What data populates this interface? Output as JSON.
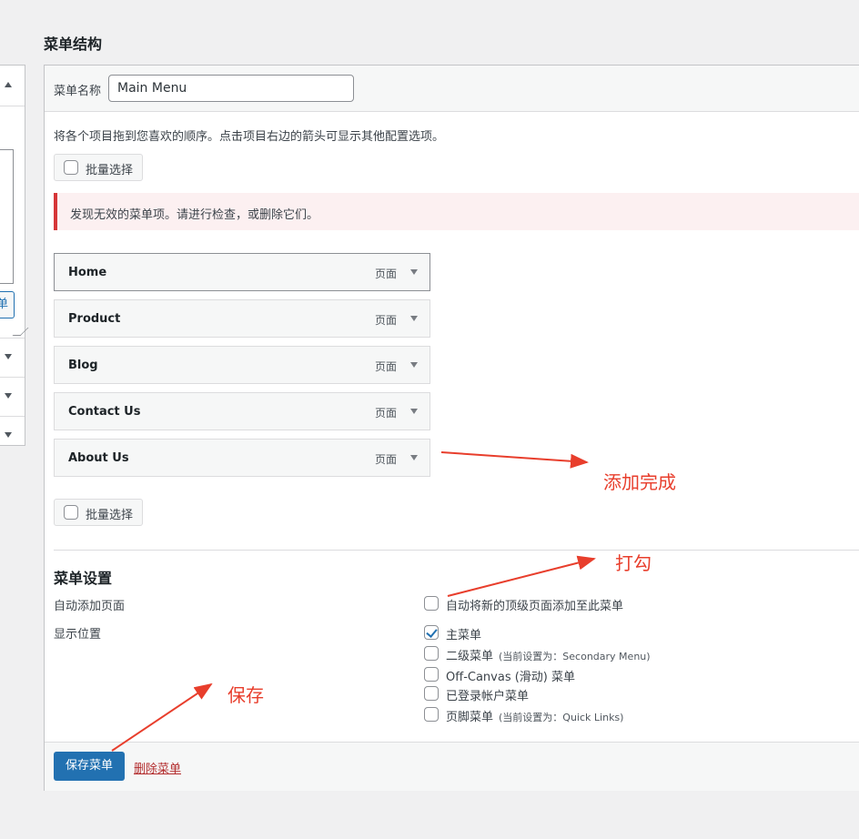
{
  "section_title": "菜单结构",
  "menu_name": {
    "label": "菜单名称",
    "value": "Main Menu"
  },
  "instructions": "将各个项目拖到您喜欢的顺序。点击项目右边的箭头可显示其他配置选项。",
  "bulk_select": "批量选择",
  "notice": "发现无效的菜单项。请进行检查，或删除它们。",
  "menu_items": [
    {
      "title": "Home",
      "type": "页面"
    },
    {
      "title": "Product",
      "type": "页面"
    },
    {
      "title": "Blog",
      "type": "页面"
    },
    {
      "title": "Contact Us",
      "type": "页面"
    },
    {
      "title": "About Us",
      "type": "页面"
    }
  ],
  "settings": {
    "title": "菜单设置",
    "auto_add": {
      "label": "自动添加页面",
      "option": "自动将新的顶级页面添加至此菜单",
      "checked": false
    },
    "display_location": {
      "label": "显示位置",
      "options": [
        {
          "label": "主菜单",
          "note": "",
          "checked": true
        },
        {
          "label": "二级菜单",
          "note": "(当前设置为：Secondary Menu)",
          "checked": false
        },
        {
          "label": "Off-Canvas (滑动) 菜单",
          "note": "",
          "checked": false
        },
        {
          "label": "已登录帐户菜单",
          "note": "",
          "checked": false
        },
        {
          "label": "页脚菜单",
          "note": "(当前设置为：Quick Links)",
          "checked": false
        }
      ]
    }
  },
  "footer": {
    "save": "保存菜单",
    "delete": "删除菜单"
  },
  "left_panel": {
    "button_fragment": "单"
  },
  "annotations": {
    "done": "添加完成",
    "check": "打勾",
    "save": "保存"
  },
  "colors": {
    "primary": "#2271b1",
    "error": "#d63638",
    "annotation": "#e83e2c",
    "delete": "#b32d2e"
  }
}
